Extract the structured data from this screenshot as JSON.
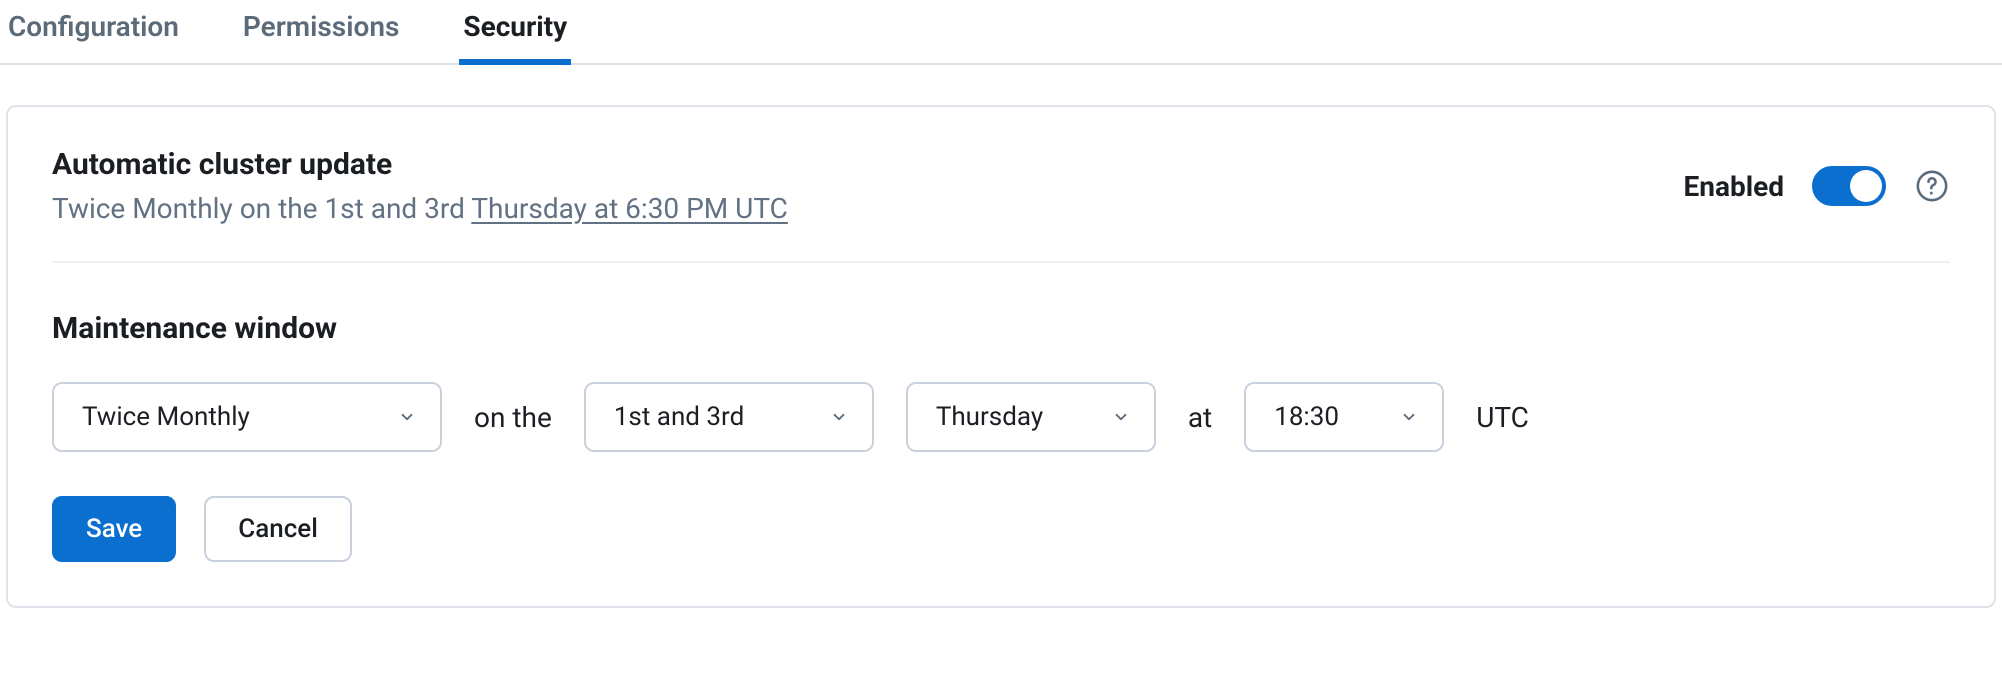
{
  "tabs": [
    {
      "label": "Configuration",
      "active": false
    },
    {
      "label": "Permissions",
      "active": false
    },
    {
      "label": "Security",
      "active": true
    }
  ],
  "security": {
    "title": "Automatic cluster update",
    "schedule_prefix": "Twice Monthly on the 1st and 3rd ",
    "schedule_link": "Thursday at 6:30 PM UTC",
    "enabled_label": "Enabled",
    "enabled": true
  },
  "maintenance": {
    "title": "Maintenance window",
    "frequency": "Twice Monthly",
    "on_the_label": "on the",
    "ordinal": "1st and 3rd",
    "day": "Thursday",
    "at_label": "at",
    "time": "18:30",
    "tz_label": "UTC"
  },
  "actions": {
    "save": "Save",
    "cancel": "Cancel"
  }
}
